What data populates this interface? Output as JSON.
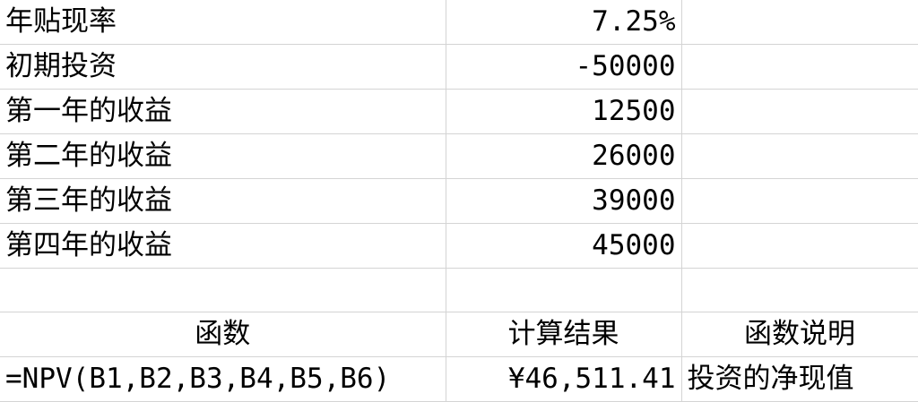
{
  "rows": [
    {
      "label": "年贴现率",
      "value": "7.25%"
    },
    {
      "label": "初期投资",
      "value": "-50000"
    },
    {
      "label": "第一年的收益",
      "value": "12500"
    },
    {
      "label": "第二年的收益",
      "value": "26000"
    },
    {
      "label": "第三年的收益",
      "value": "39000"
    },
    {
      "label": "第四年的收益",
      "value": "45000"
    }
  ],
  "headers": {
    "function": "函数",
    "result": "计算结果",
    "description": "函数说明"
  },
  "example": {
    "formula": "=NPV(B1,B2,B3,B4,B5,B6)",
    "result": "¥46,511.41",
    "description": "投资的净现值"
  }
}
